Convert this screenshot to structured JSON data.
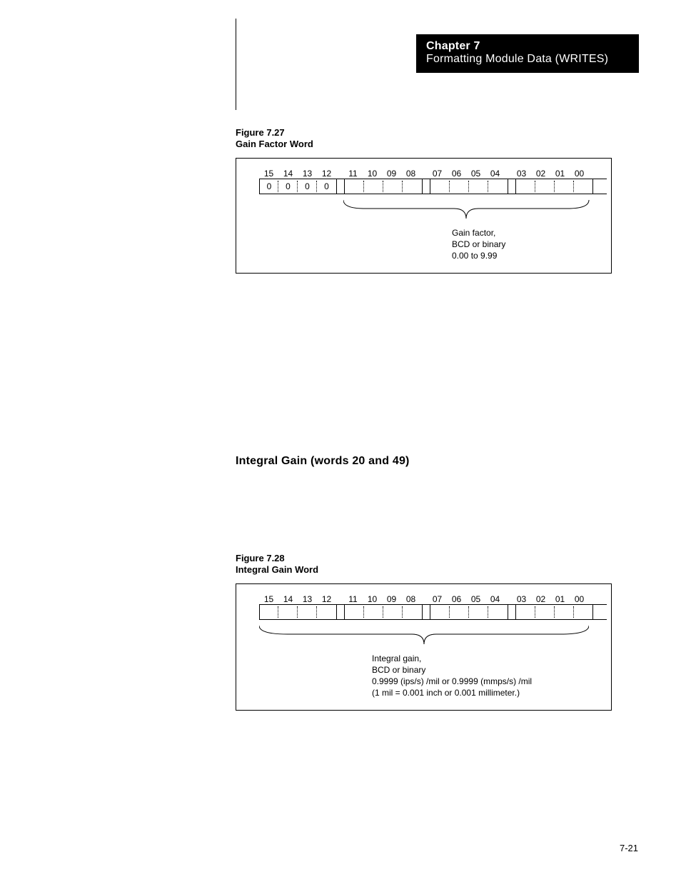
{
  "chapter": {
    "label": "Chapter 7",
    "title": "Formatting Module Data (WRITES)"
  },
  "figure1": {
    "number": "Figure 7.27",
    "title": "Gain Factor Word",
    "bit_labels": [
      "15",
      "14",
      "13",
      "12",
      "11",
      "10",
      "09",
      "08",
      "07",
      "06",
      "05",
      "04",
      "03",
      "02",
      "01",
      "00"
    ],
    "high_nibble_values": [
      "0",
      "0",
      "0",
      "0"
    ],
    "annotation": {
      "line1": "Gain factor,",
      "line2": "BCD or binary",
      "line3": "0.00 to 9.99"
    }
  },
  "section2": {
    "heading": "Integral Gain (words 20 and 49)"
  },
  "figure2": {
    "number": "Figure 7.28",
    "title": "Integral Gain Word",
    "bit_labels": [
      "15",
      "14",
      "13",
      "12",
      "11",
      "10",
      "09",
      "08",
      "07",
      "06",
      "05",
      "04",
      "03",
      "02",
      "01",
      "00"
    ],
    "annotation": {
      "line1": "Integral gain,",
      "line2": "BCD or binary",
      "line3": "0.9999 (ips/s) /mil or 0.9999 (mmps/s) /mil",
      "line4": "(1 mil = 0.001 inch or 0.001 millimeter.)"
    }
  },
  "page_number": "7-21"
}
